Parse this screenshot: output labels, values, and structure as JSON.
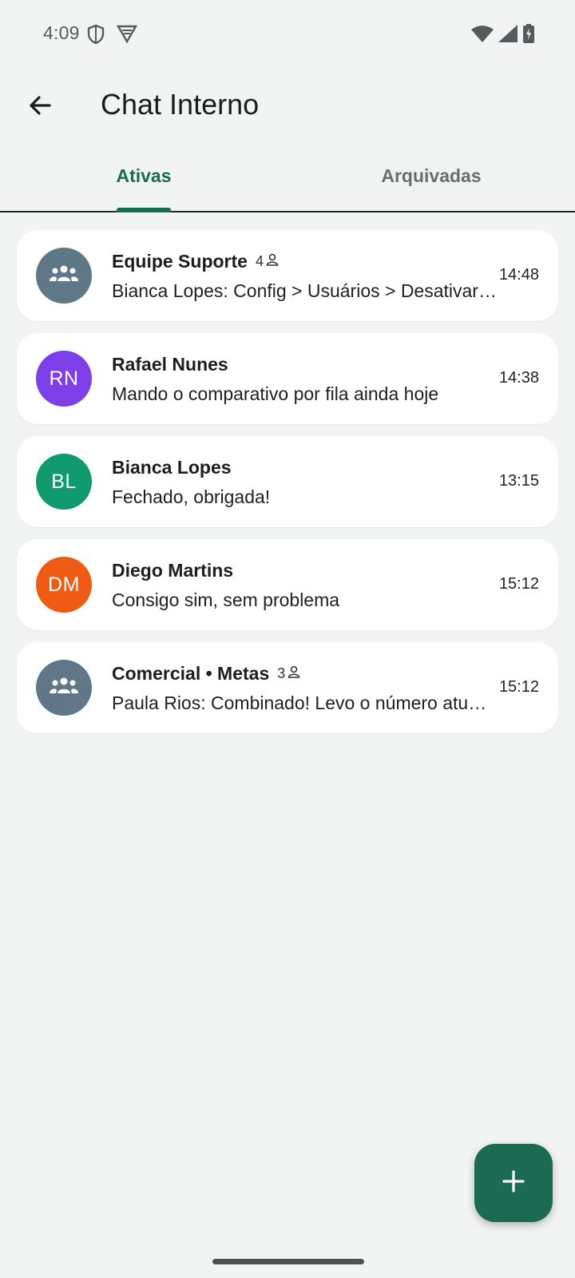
{
  "status_bar": {
    "time": "4:09",
    "icons": [
      "shield-icon",
      "vpn-icon",
      "wifi-icon",
      "cell-signal-icon",
      "battery-charging-icon"
    ]
  },
  "app_bar": {
    "back_icon": "arrow-back-icon",
    "title": "Chat Interno"
  },
  "tabs": [
    {
      "label": "Ativas",
      "active": true
    },
    {
      "label": "Arquivadas",
      "active": false
    }
  ],
  "chats": [
    {
      "name": "Equipe Suporte",
      "is_group": true,
      "member_count": "4",
      "avatar_icon": "group-icon",
      "avatar_color": "#607787",
      "preview": "Bianca Lopes: Config > Usuários > Desativar conta",
      "time": "14:48"
    },
    {
      "name": "Rafael Nunes",
      "is_group": false,
      "initials": "RN",
      "avatar_color": "#7e3fe8",
      "preview": "Mando o comparativo por fila ainda hoje",
      "time": "14:38"
    },
    {
      "name": "Bianca Lopes",
      "is_group": false,
      "initials": "BL",
      "avatar_color": "#109a6e",
      "preview": "Fechado, obrigada!",
      "time": "13:15"
    },
    {
      "name": "Diego Martins",
      "is_group": false,
      "initials": "DM",
      "avatar_color": "#ee5b14",
      "preview": "Consigo sim, sem problema",
      "time": "15:12"
    },
    {
      "name": "Comercial • Metas",
      "is_group": true,
      "member_count": "3",
      "avatar_icon": "group-icon",
      "avatar_color": "#607787",
      "preview": "Paula Rios: Combinado! Levo o número atualizado amanhã",
      "time": "15:12"
    }
  ],
  "fab": {
    "icon": "plus-icon"
  },
  "colors": {
    "accent": "#1b6a52",
    "background": "#f1f4f3",
    "card": "#ffffff"
  }
}
